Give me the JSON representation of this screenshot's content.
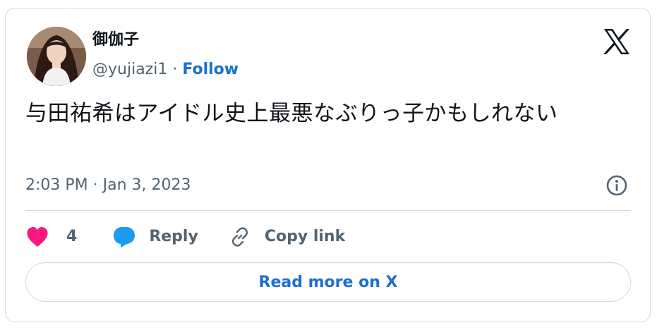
{
  "tweet": {
    "display_name": "御伽子",
    "handle": "@yujiazi1",
    "separator": " · ",
    "follow_label": "Follow",
    "text": "与田祐希はアイドル史上最悪なぶりっ子かもしれない",
    "timestamp": "2:03 PM · Jan 3, 2023",
    "like_count": "4",
    "reply_label": "Reply",
    "copy_link_label": "Copy link",
    "read_more_label": "Read more on X"
  },
  "icons": {
    "logo": "x-logo-icon",
    "info": "info-icon",
    "like": "heart-icon",
    "reply": "speech-bubble-icon",
    "copy": "link-icon"
  },
  "colors": {
    "accent": "#1d6fce",
    "heart": "#f91880",
    "reply_icon": "#1d9bf0",
    "muted_text": "#536471",
    "border": "#cfd9de",
    "primary_text": "#0f1419"
  }
}
